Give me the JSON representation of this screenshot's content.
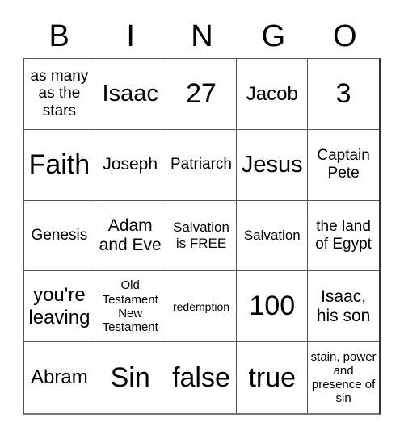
{
  "header": [
    "B",
    "I",
    "N",
    "G",
    "O"
  ],
  "cells": [
    [
      "as many as the stars",
      "Isaac",
      "27",
      "Jacob",
      "3"
    ],
    [
      "Faith",
      "Joseph",
      "Patriarch",
      "Jesus",
      "Captain Pete"
    ],
    [
      "Genesis",
      "Adam and Eve",
      "Salvation is FREE",
      "Salvation",
      "the land of Egypt"
    ],
    [
      "you're leaving",
      "Old Testament New Testament",
      "redemption",
      "100",
      "Isaac, his son"
    ],
    [
      "Abram",
      "Sin",
      "false",
      "true",
      "stain, power and presence of sin"
    ]
  ]
}
